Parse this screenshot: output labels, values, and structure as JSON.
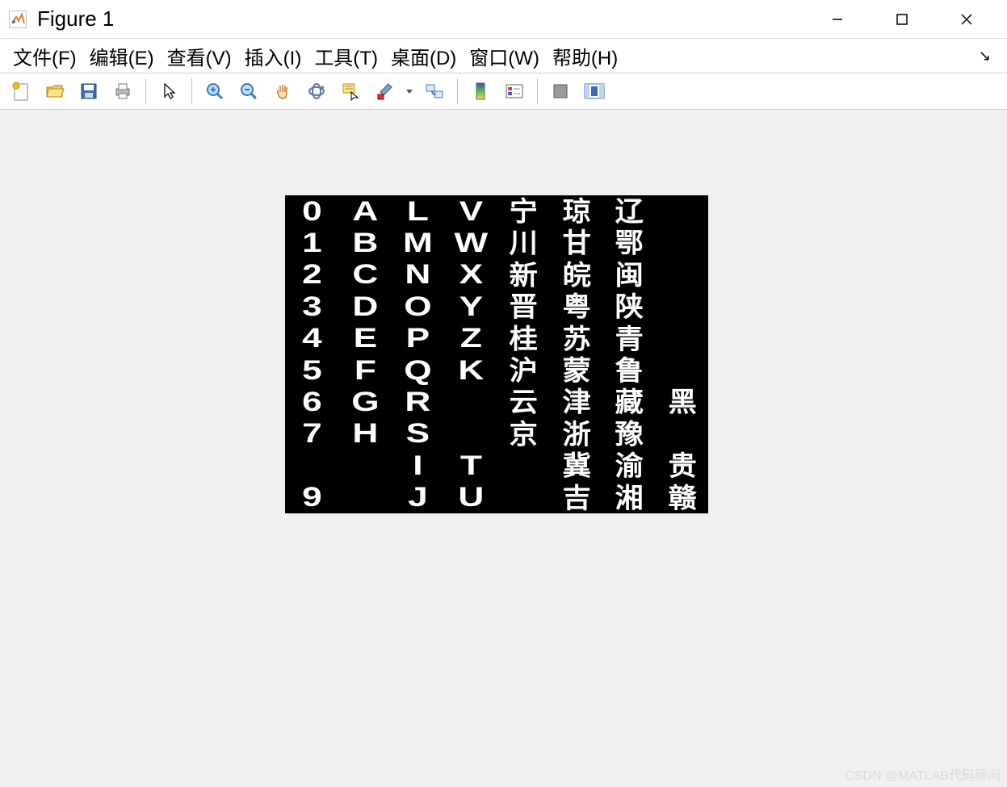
{
  "window": {
    "title": "Figure 1"
  },
  "menu": {
    "file": "文件(F)",
    "edit": "编辑(E)",
    "view": "查看(V)",
    "insert": "插入(I)",
    "tools": "工具(T)",
    "desktop": "桌面(D)",
    "window": "窗口(W)",
    "help": "帮助(H)"
  },
  "toolbar_icons": {
    "new": "new-figure-icon",
    "open": "open-icon",
    "save": "save-icon",
    "print": "print-icon",
    "pointer": "pointer-icon",
    "zoom_in": "zoom-in-icon",
    "zoom_out": "zoom-out-icon",
    "pan": "pan-icon",
    "rotate": "rotate-icon",
    "data_cursor": "data-cursor-icon",
    "brush": "brush-icon",
    "link": "link-icon",
    "colorbar": "colorbar-icon",
    "legend": "legend-icon",
    "hide": "hide-plot-tools-icon",
    "show": "show-plot-tools-icon"
  },
  "figure_content": {
    "grid": [
      [
        "0",
        "A",
        "L",
        "V",
        "宁",
        "琼",
        "辽",
        ""
      ],
      [
        "1",
        "B",
        "M",
        "W",
        "川",
        "甘",
        "鄂",
        ""
      ],
      [
        "2",
        "C",
        "N",
        "X",
        "新",
        "皖",
        "闽",
        ""
      ],
      [
        "3",
        "D",
        "O",
        "Y",
        "晋",
        "粤",
        "陕",
        ""
      ],
      [
        "4",
        "E",
        "P",
        "Z",
        "桂",
        "苏",
        "青",
        ""
      ],
      [
        "5",
        "F",
        "Q",
        "K",
        "沪",
        "蒙",
        "鲁",
        ""
      ],
      [
        "6",
        "G",
        "R",
        "",
        "云",
        "津",
        "藏",
        "黑"
      ],
      [
        "7",
        "H",
        "S",
        "",
        "京",
        "浙",
        "豫",
        ""
      ],
      [
        "",
        "",
        "I",
        "T",
        "",
        "冀",
        "渝",
        "贵"
      ],
      [
        "9",
        "",
        "J",
        "U",
        "",
        "吉",
        "湘",
        "赣"
      ]
    ]
  },
  "watermark": "CSDN @MATLAB代码顾问"
}
